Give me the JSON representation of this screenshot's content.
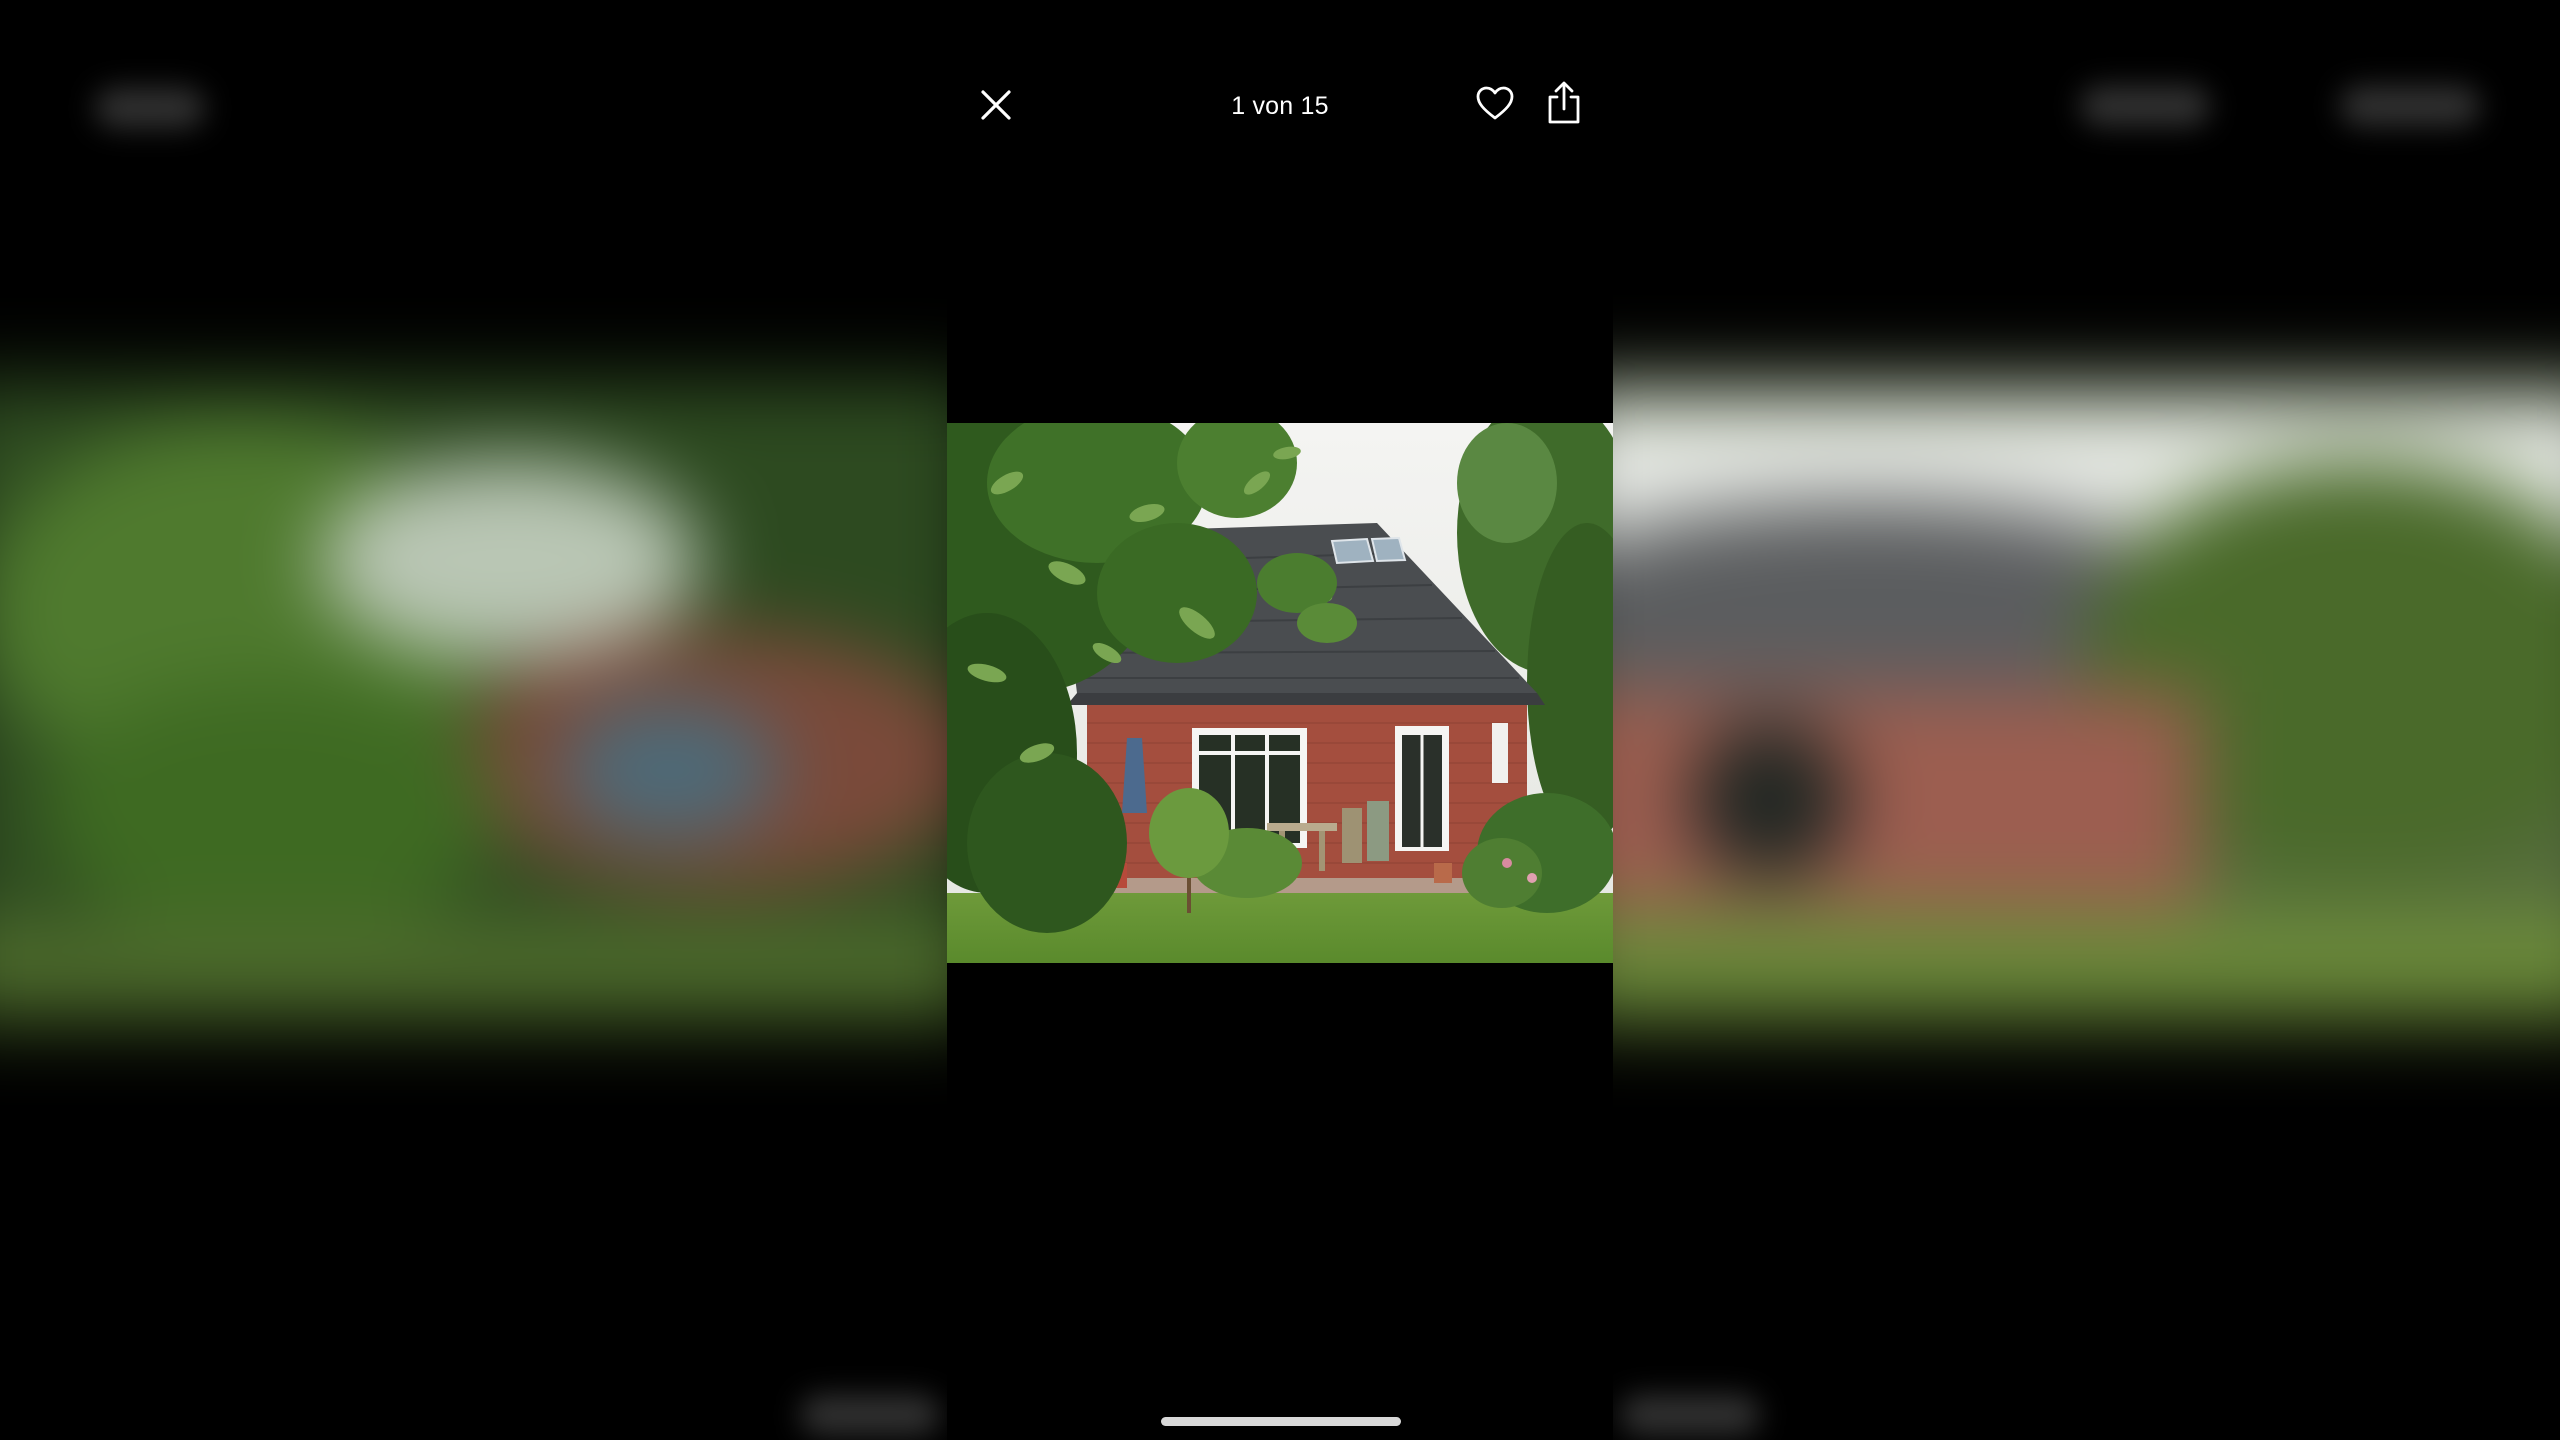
{
  "viewer": {
    "counter": "1 von 15",
    "current_index": 1,
    "total_images": 15
  },
  "actions": {
    "close_icon": "close-icon",
    "favorite_icon": "heart-icon",
    "share_icon": "share-icon"
  },
  "colors": {
    "background": "#000000",
    "foreground": "#ffffff",
    "home_indicator": "#d8d8d8"
  }
}
